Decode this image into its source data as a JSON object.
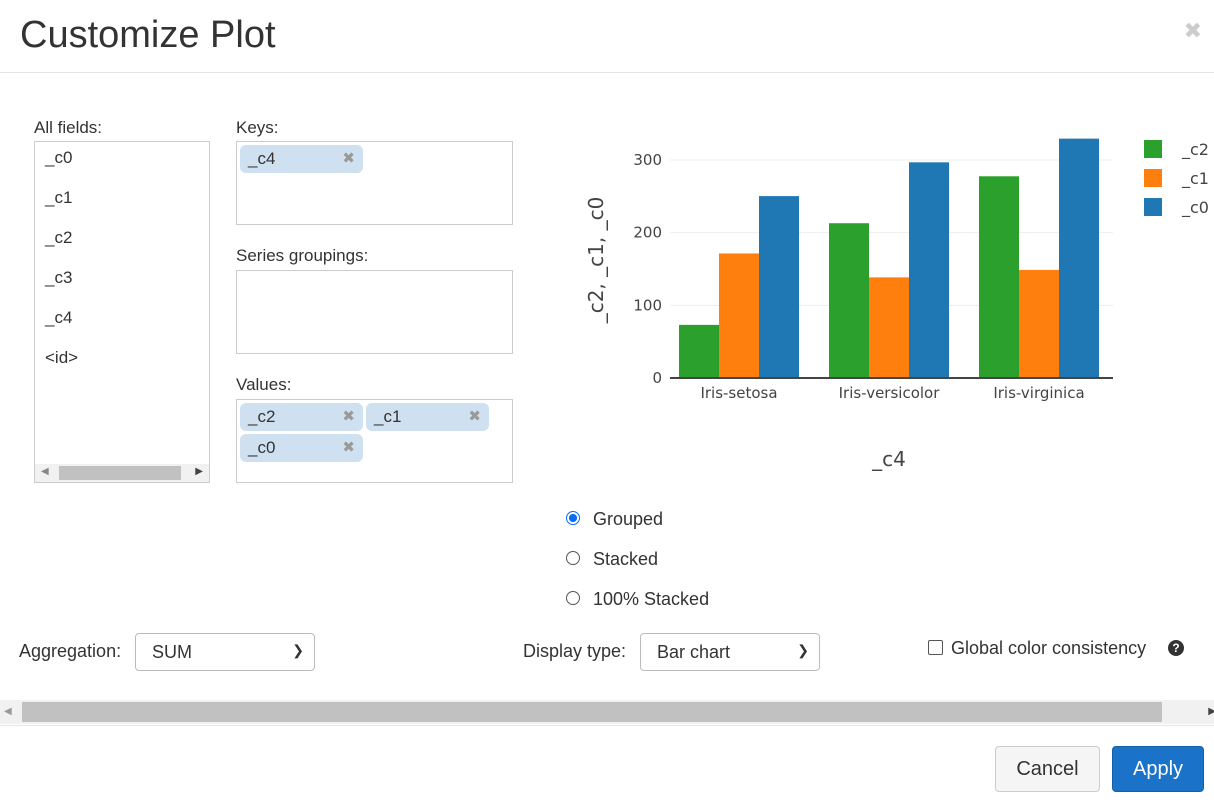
{
  "dialog": {
    "title": "Customize Plot",
    "close_icon": "close-icon"
  },
  "all_fields": {
    "label": "All fields:",
    "items": [
      "_c0",
      "_c1",
      "_c2",
      "_c3",
      "_c4",
      "<id>"
    ]
  },
  "keys": {
    "label": "Keys:",
    "chips": [
      "_c4"
    ]
  },
  "series_groupings": {
    "label": "Series groupings:",
    "chips": []
  },
  "values": {
    "label": "Values:",
    "chips": [
      "_c2",
      "_c1",
      "_c0"
    ]
  },
  "mode": {
    "options": [
      "Grouped",
      "Stacked",
      "100% Stacked"
    ],
    "selected": "Grouped"
  },
  "aggregation": {
    "label": "Aggregation:",
    "value": "SUM"
  },
  "display_type": {
    "label": "Display type:",
    "value": "Bar chart"
  },
  "global_color": {
    "label": "Global color consistency",
    "checked": false
  },
  "buttons": {
    "cancel": "Cancel",
    "apply": "Apply"
  },
  "colors": {
    "accent": "#1a73c8"
  },
  "chart_data": {
    "type": "bar",
    "mode": "grouped",
    "categories": [
      "Iris-setosa",
      "Iris-versicolor",
      "Iris-virginica"
    ],
    "series": [
      {
        "name": "_c2",
        "color": "#2ca02c",
        "values": [
          73.1,
          213.0,
          277.6
        ]
      },
      {
        "name": "_c1",
        "color": "#ff7f0e",
        "values": [
          171.4,
          138.5,
          148.7
        ]
      },
      {
        "name": "_c0",
        "color": "#1f77b4",
        "values": [
          250.3,
          296.8,
          329.4
        ]
      }
    ],
    "xlabel": "_c4",
    "ylabel": "_c2, _c1, _c0",
    "yticks": [
      0,
      100,
      200,
      300
    ],
    "ylim": [
      0,
      330
    ],
    "grid": true,
    "legend": "top-right"
  }
}
